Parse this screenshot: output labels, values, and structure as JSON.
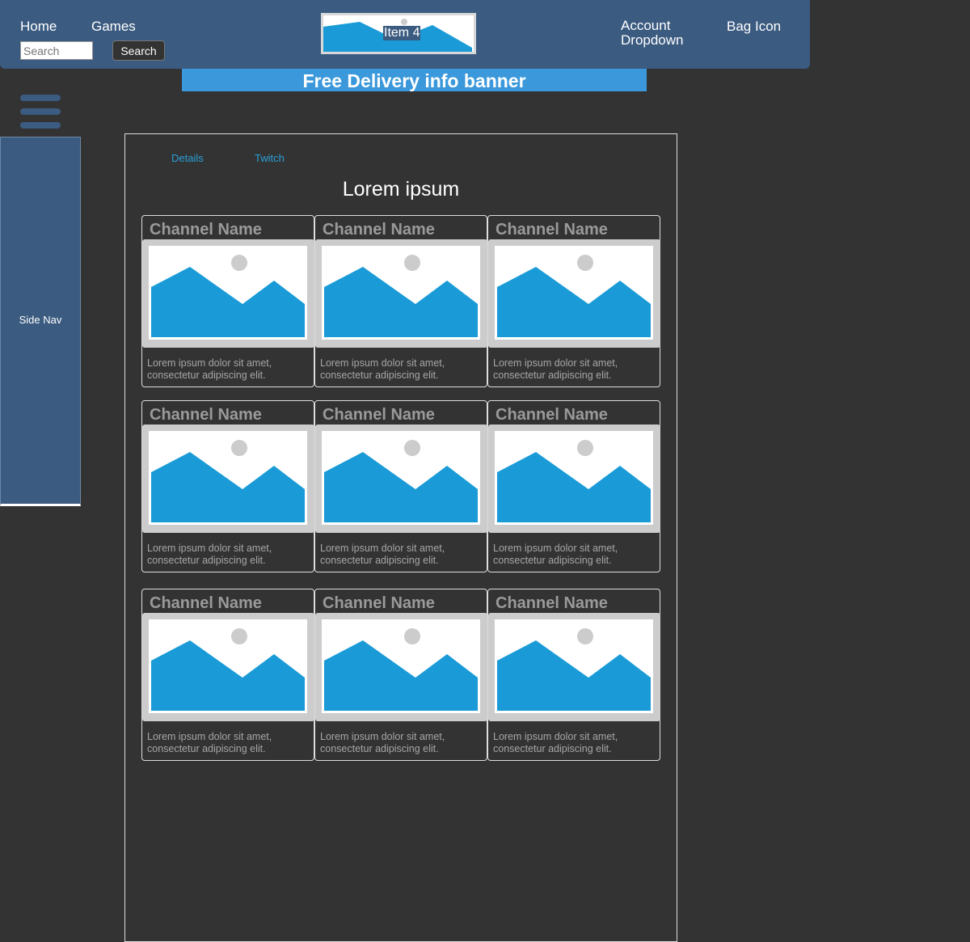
{
  "header": {
    "home_label": "Home",
    "games_label": "Games",
    "search_placeholder": "Search",
    "search_button": "Search",
    "logo_label": "Item 4",
    "account_label": "Account Dropdown",
    "bag_label": "Bag Icon"
  },
  "banner": {
    "text": "Free Delivery info banner"
  },
  "sidenav": {
    "label": "Side Nav",
    "menu_icon": "hamburger-icon"
  },
  "main": {
    "tabs": [
      {
        "label": "Details"
      },
      {
        "label": "Twitch"
      }
    ],
    "title": "Lorem ipsum",
    "cards": [
      {
        "title": "Channel Name",
        "desc": "Lorem ipsum dolor sit amet, consectetur adipiscing elit."
      },
      {
        "title": "Channel Name",
        "desc": "Lorem ipsum dolor sit amet, consectetur adipiscing elit."
      },
      {
        "title": "Channel Name",
        "desc": "Lorem ipsum dolor sit amet, consectetur adipiscing elit."
      },
      {
        "title": "Channel Name",
        "desc": "Lorem ipsum dolor sit amet, consectetur adipiscing elit."
      },
      {
        "title": "Channel Name",
        "desc": "Lorem ipsum dolor sit amet, consectetur adipiscing elit."
      },
      {
        "title": "Channel Name",
        "desc": "Lorem ipsum dolor sit amet, consectetur adipiscing elit."
      },
      {
        "title": "Channel Name",
        "desc": "Lorem ipsum dolor sit amet, consectetur adipiscing elit."
      },
      {
        "title": "Channel Name",
        "desc": "Lorem ipsum dolor sit amet, consectetur adipiscing elit."
      },
      {
        "title": "Channel Name",
        "desc": "Lorem ipsum dolor sit amet, consectetur adipiscing elit."
      }
    ]
  },
  "colors": {
    "background": "#333333",
    "header": "#3b5b80",
    "banner": "#3a98db",
    "image_accent": "#1a9bd7",
    "tab_link": "#2a9fd8"
  }
}
